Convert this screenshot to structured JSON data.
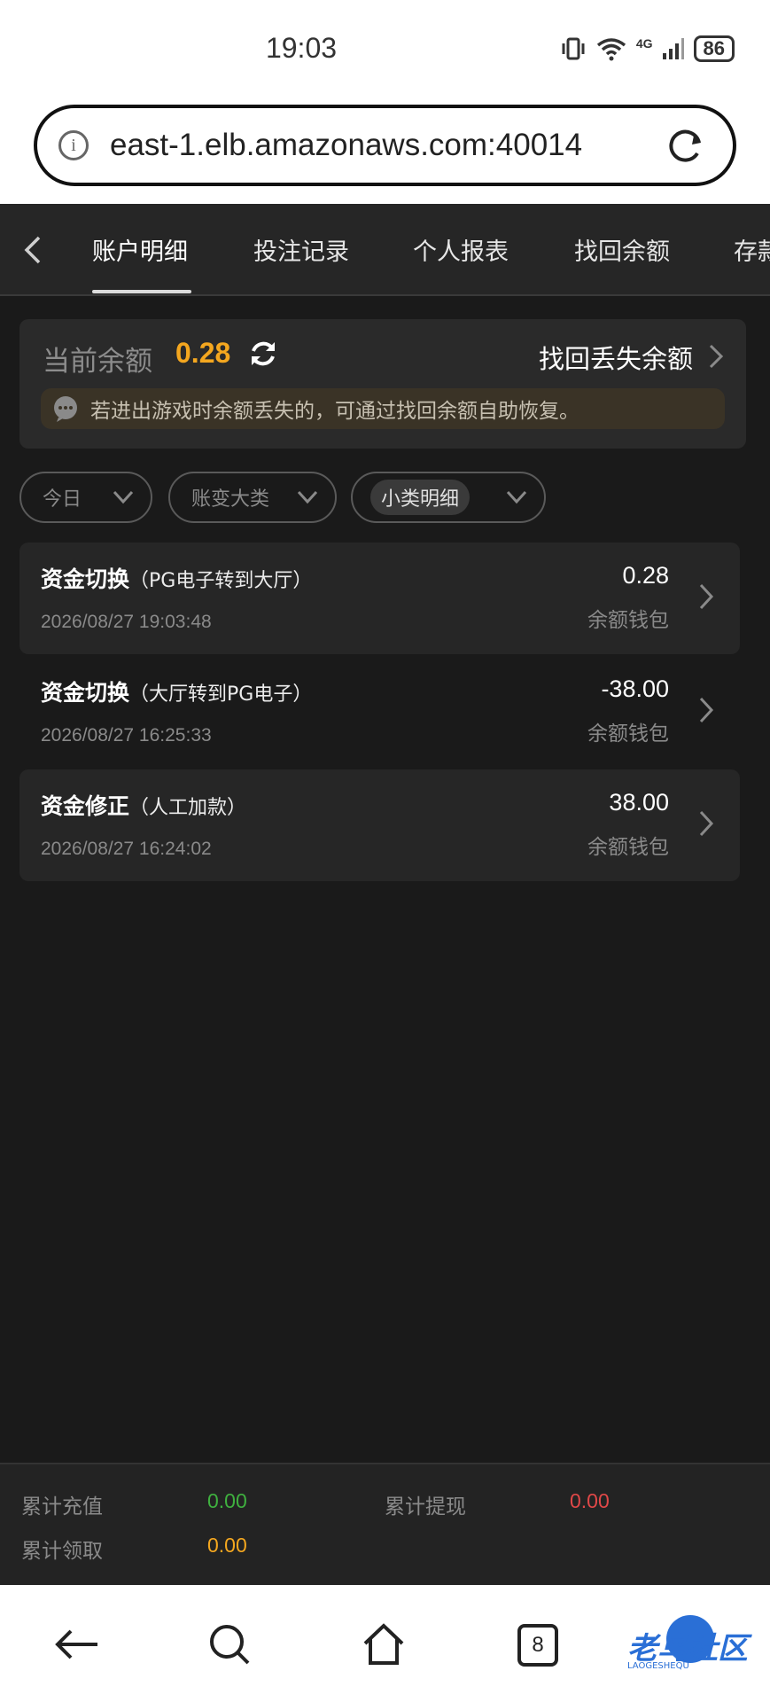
{
  "status": {
    "time": "19:03",
    "battery": "86",
    "network": "4G"
  },
  "browser": {
    "url": "east-1.elb.amazonaws.com:40014"
  },
  "tabs": [
    {
      "label": "账户明细",
      "active": true
    },
    {
      "label": "投注记录"
    },
    {
      "label": "个人报表"
    },
    {
      "label": "找回余额"
    },
    {
      "label": "存款"
    }
  ],
  "balance": {
    "label": "当前余额",
    "value": "0.28",
    "recover_label": "找回丢失余额",
    "notice": "若进出游戏时余额丢失的，可通过找回余额自助恢复。"
  },
  "filters": [
    {
      "label": "今日"
    },
    {
      "label": "账变大类"
    },
    {
      "label": "小类明细"
    }
  ],
  "records": [
    {
      "title": "资金切换",
      "detail": "（PG电子转到大厅）",
      "time": "2026/08/27 19:03:48",
      "amount": "0.28",
      "wallet": "余额钱包"
    },
    {
      "title": "资金切换",
      "detail": "（大厅转到PG电子）",
      "time": "2026/08/27 16:25:33",
      "amount": "-38.00",
      "wallet": "余额钱包"
    },
    {
      "title": "资金修正",
      "detail": "（人工加款）",
      "time": "2026/08/27 16:24:02",
      "amount": "38.00",
      "wallet": "余额钱包"
    }
  ],
  "summary": {
    "recharge_label": "累计充值",
    "recharge_value": "0.00",
    "withdraw_label": "累计提现",
    "withdraw_value": "0.00",
    "claim_label": "累计领取",
    "claim_value": "0.00"
  },
  "colors": {
    "accent_orange": "#f4a71f",
    "green": "#3fb03f",
    "red": "#e04848",
    "background": "#1a1a1a"
  },
  "nav": {
    "tab_count": "8",
    "watermark": "老鸟社区",
    "watermark_sub": "LAOGESHEQU"
  }
}
